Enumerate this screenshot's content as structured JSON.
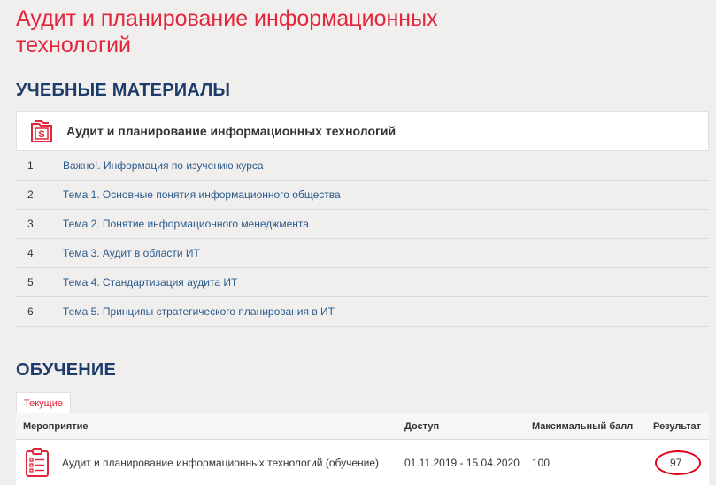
{
  "page": {
    "title": "Аудит и планирование информационных технологий"
  },
  "materials": {
    "section_title": "УЧЕБНЫЕ МАТЕРИАЛЫ",
    "course_icon": "file-s-icon",
    "course_name": "Аудит и планирование информационных технологий",
    "items": [
      {
        "num": "1",
        "label": "Важно!. Информация по изучению курса"
      },
      {
        "num": "2",
        "label": "Тема 1. Основные понятия информационного общества"
      },
      {
        "num": "3",
        "label": "Тема 2. Понятие информационного менеджмента"
      },
      {
        "num": "4",
        "label": "Тема 3. Аудит в области ИТ"
      },
      {
        "num": "5",
        "label": "Тема 4. Стандартизация аудита ИТ"
      },
      {
        "num": "6",
        "label": "Тема 5. Принципы стратегического планирования в ИТ"
      }
    ]
  },
  "learning": {
    "section_title": "ОБУЧЕНИЕ",
    "tab_label": "Текущие",
    "headers": {
      "event": "Мероприятие",
      "access": "Доступ",
      "max_score": "Максимальный балл",
      "result": "Результат"
    },
    "rows": [
      {
        "icon": "clipboard-list-icon",
        "event": "Аудит и планирование информационных технологий (обучение)",
        "access": "01.11.2019 - 15.04.2020",
        "max_score": "100",
        "result": "97"
      }
    ]
  },
  "colors": {
    "accent_red": "#e2263b",
    "heading_blue": "#1d3c6b",
    "link_blue": "#2a5a8c",
    "highlight_circle": "#e0001a"
  }
}
